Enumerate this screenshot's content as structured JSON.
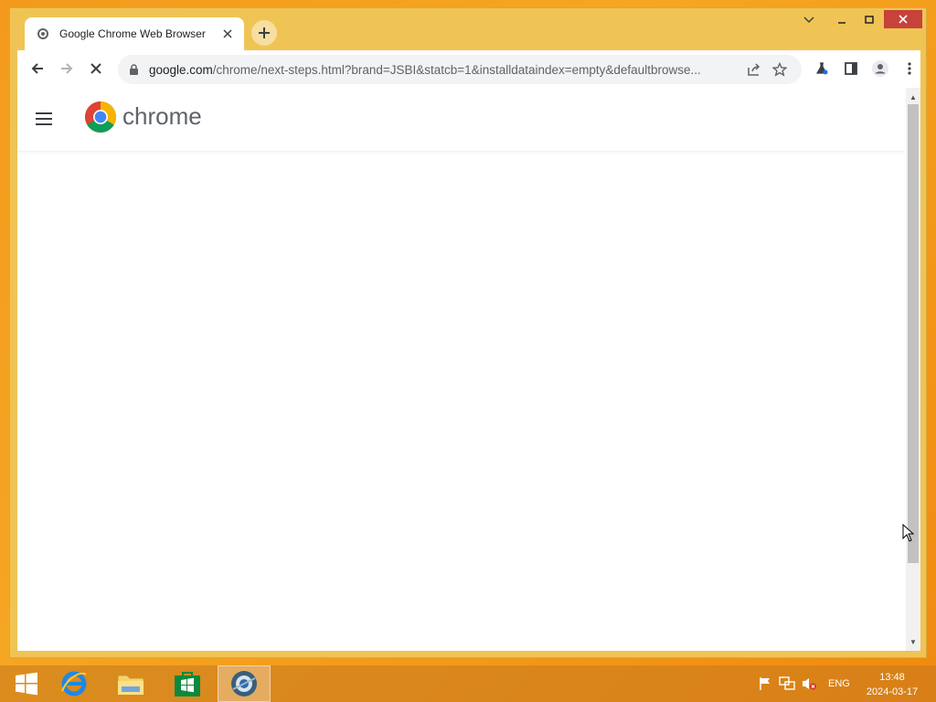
{
  "window": {
    "tab_title": "Google Chrome Web Browser",
    "url_host": "google.com",
    "url_rest": "/chrome/next-steps.html?brand=JSBI&statcb=1&installdataindex=empty&defaultbrowse..."
  },
  "page": {
    "logo_text": "chrome"
  },
  "taskbar": {
    "language": "ENG",
    "time": "13:48",
    "date": "2024-03-17"
  },
  "colors": {
    "desktop": "#f5a623",
    "titlebar": "#f0c454",
    "close_button": "#c7423a"
  }
}
